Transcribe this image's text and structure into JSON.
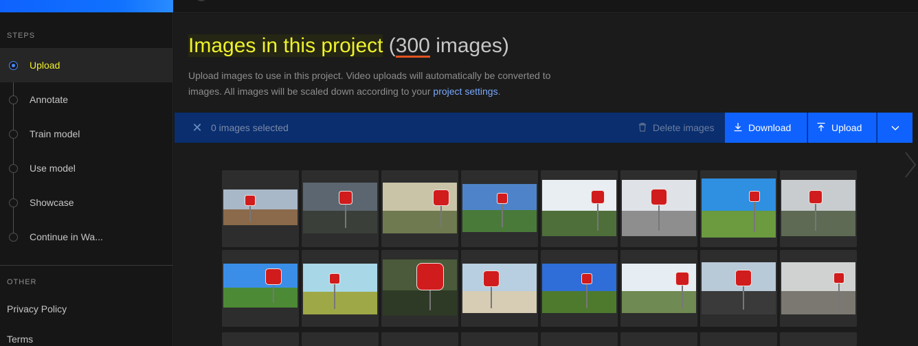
{
  "sidebar": {
    "steps_title": "STEPS",
    "steps": [
      {
        "label": "Upload",
        "active": true
      },
      {
        "label": "Annotate",
        "active": false
      },
      {
        "label": "Train model",
        "active": false
      },
      {
        "label": "Use model",
        "active": false
      },
      {
        "label": "Showcase",
        "active": false
      },
      {
        "label": "Continue in Wa...",
        "active": false
      }
    ],
    "other_title": "OTHER",
    "links": [
      "Privacy Policy",
      "Terms"
    ]
  },
  "main": {
    "title_text": "Images in this project",
    "title_open": " (",
    "title_count": "300",
    "title_suffix": " images)",
    "description_prefix": "Upload images to use in this project. Video uploads will automatically be converted to images. All images will be scaled down according to your ",
    "description_link": "project settings",
    "description_suffix": "."
  },
  "action_bar": {
    "selected_text": "0 images selected",
    "delete_label": "Delete images",
    "download_label": "Download",
    "upload_label": "Upload"
  },
  "colors": {
    "accent_blue": "#0f62fe",
    "action_bar": "#0a2e6e",
    "highlight_yellow": "#eef22b",
    "underline_orange": "#e0531f"
  },
  "thumbnails": [
    {
      "sky": "#a9b8c9",
      "ground": "#8a6a4a"
    },
    {
      "sky": "#5c6670",
      "ground": "#3a3f3a"
    },
    {
      "sky": "#c9c4a8",
      "ground": "#6f7a50"
    },
    {
      "sky": "#4f83c9",
      "ground": "#4a7a3a"
    },
    {
      "sky": "#e8eef2",
      "ground": "#4f6f3a"
    },
    {
      "sky": "#dfe3e8",
      "ground": "#8e8e8e"
    },
    {
      "sky": "#2f8fe0",
      "ground": "#6b9a3f"
    },
    {
      "sky": "#c8ccce",
      "ground": "#5f6a55"
    },
    {
      "sky": "#3a8ee8",
      "ground": "#4c8a36"
    },
    {
      "sky": "#a8d8e8",
      "ground": "#9fa846"
    },
    {
      "sky": "#4a5a3a",
      "ground": "#2e3a26"
    },
    {
      "sky": "#b7cfe0",
      "ground": "#d7cdb5"
    },
    {
      "sky": "#2f6dd8",
      "ground": "#4e7a2e"
    },
    {
      "sky": "#e7eef3",
      "ground": "#6f8a52"
    },
    {
      "sky": "#b8c9d8",
      "ground": "#3a3a3a"
    },
    {
      "sky": "#d0d2d2",
      "ground": "#7a7870"
    }
  ]
}
